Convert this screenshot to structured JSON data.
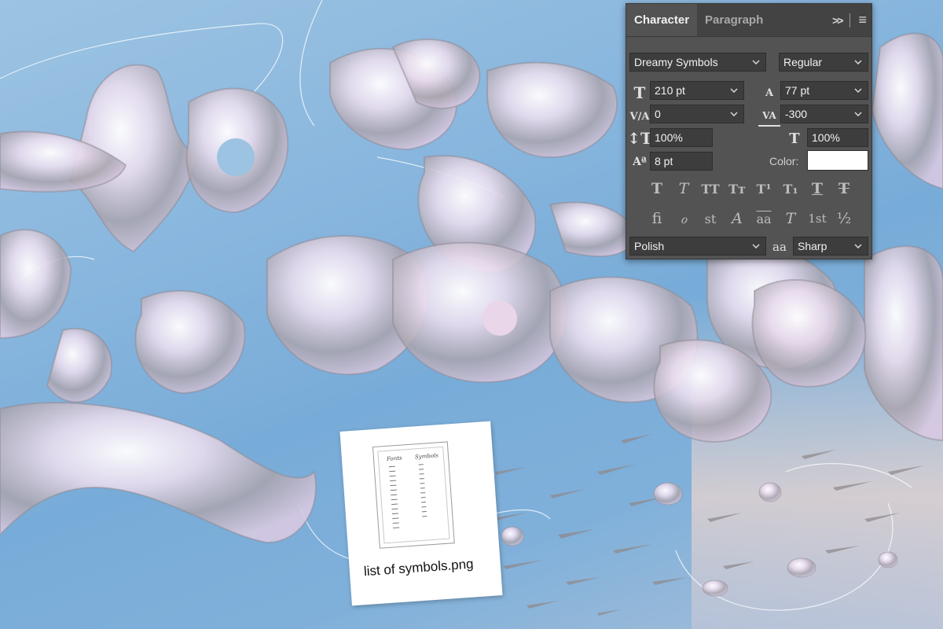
{
  "panel": {
    "tabs": {
      "character": "Character",
      "paragraph": "Paragraph"
    },
    "tools": {
      "expand": ">>",
      "menu": "≡"
    },
    "font_family": "Dreamy Symbols",
    "font_style": "Regular",
    "font_size": "210 pt",
    "leading": "77 pt",
    "kerning": "0",
    "tracking": "-300",
    "vertical_scale": "100%",
    "horizontal_scale": "100%",
    "baseline_shift": "8 pt",
    "color_label": "Color:",
    "color_value": "#ffffff",
    "style_buttons": [
      "T",
      "T",
      "TT",
      "Tт",
      "T¹",
      "T₁",
      "T",
      "T"
    ],
    "opentype_buttons": [
      "ﬁ",
      "ℴ",
      "st",
      "A",
      "aa",
      "T",
      "1st",
      "½"
    ],
    "language": "Polish",
    "antialias_icon": "aa",
    "antialias": "Sharp"
  },
  "card": {
    "caption": "list of symbols.png",
    "doc_headings": [
      "Fonts",
      "Symbols"
    ]
  },
  "icons": {
    "size": "font-size-icon",
    "leading": "leading-icon",
    "kerning": "kerning-icon",
    "tracking": "tracking-icon",
    "vscale": "vertical-scale-icon",
    "hscale": "horizontal-scale-icon",
    "baseline": "baseline-shift-icon"
  }
}
